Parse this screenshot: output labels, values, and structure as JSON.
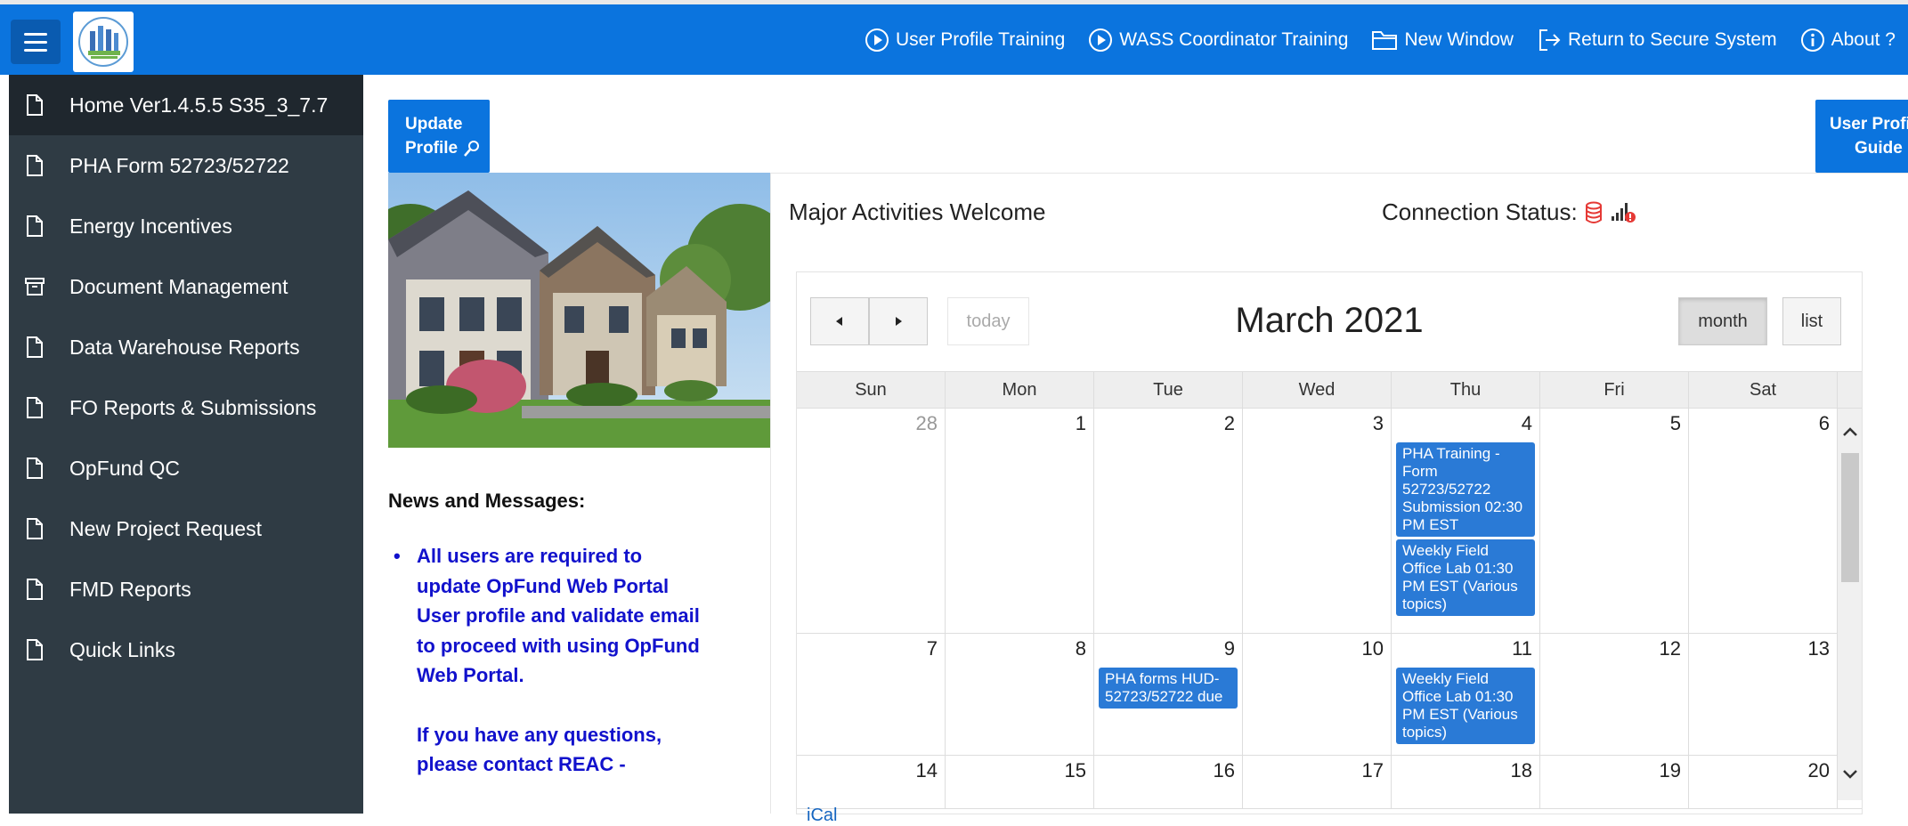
{
  "header": {
    "nav": [
      {
        "label": "User Profile Training",
        "icon": "play-circle-icon"
      },
      {
        "label": "WASS Coordinator Training",
        "icon": "play-circle-icon"
      },
      {
        "label": "New Window",
        "icon": "folder-icon"
      },
      {
        "label": "Return to Secure System",
        "icon": "sign-out-icon"
      },
      {
        "label": "About ?",
        "icon": "info-circle-icon"
      }
    ]
  },
  "sidebar": {
    "items": [
      {
        "label": "Home Ver1.4.5.5 S35_3_7.7",
        "icon": "file-icon"
      },
      {
        "label": "PHA Form 52723/52722",
        "icon": "file-icon"
      },
      {
        "label": "Energy Incentives",
        "icon": "file-icon"
      },
      {
        "label": "Document Management",
        "icon": "archive-icon"
      },
      {
        "label": "Data Warehouse Reports",
        "icon": "file-icon"
      },
      {
        "label": "FO Reports & Submissions",
        "icon": "file-icon"
      },
      {
        "label": "OpFund QC",
        "icon": "file-icon"
      },
      {
        "label": "New Project Request",
        "icon": "file-icon"
      },
      {
        "label": "FMD Reports",
        "icon": "file-icon"
      },
      {
        "label": "Quick Links",
        "icon": "file-icon"
      }
    ]
  },
  "main": {
    "update_profile": {
      "line1": "Update",
      "line2": "Profile"
    },
    "user_guide": {
      "line1": "User Profi",
      "line2": "Guide"
    },
    "news_title": "News and Messages:",
    "news_p1": "All users are required to update OpFund Web Portal User profile and validate email to proceed with using OpFund Web Portal.",
    "news_p2": "If you have any questions, please contact REAC -",
    "region_title": "Major Activities Welcome",
    "connection_label": "Connection Status:",
    "colors": {
      "topbar": "#0b74de",
      "sidebar": "#2f3b44",
      "event": "#2a7ad6",
      "news": "#1111cc"
    }
  },
  "calendar": {
    "title": "March 2021",
    "today_label": "today",
    "view_month": "month",
    "view_list": "list",
    "ical": "iCal",
    "weekdays": [
      "Sun",
      "Mon",
      "Tue",
      "Wed",
      "Thu",
      "Fri",
      "Sat"
    ],
    "week1": [
      "28",
      "1",
      "2",
      "3",
      "4",
      "5",
      "6"
    ],
    "week2": [
      "7",
      "8",
      "9",
      "10",
      "11",
      "12",
      "13"
    ],
    "week3": [
      "14",
      "15",
      "16",
      "17",
      "18",
      "19",
      "20"
    ],
    "events": {
      "mar4_a": "PHA Training - Form 52723/52722 Submission 02:30 PM EST",
      "mar4_b": "Weekly Field Office Lab 01:30 PM EST (Various topics)",
      "mar9": "PHA forms HUD-52723/52722 due",
      "mar11": "Weekly Field Office Lab 01:30 PM EST (Various topics)"
    }
  }
}
